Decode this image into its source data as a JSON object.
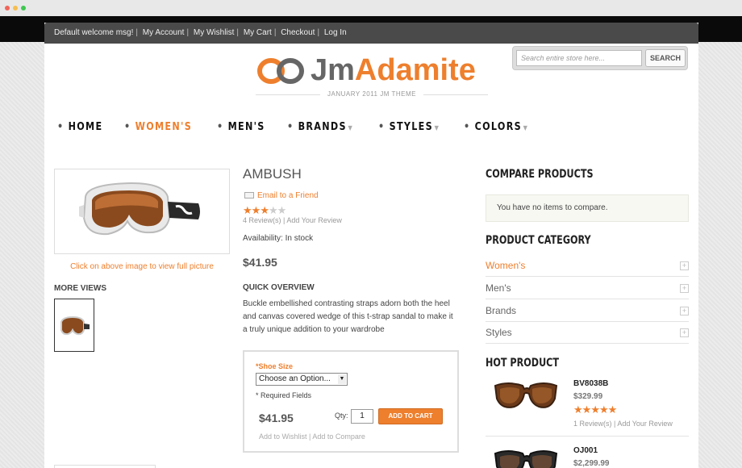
{
  "colors": {
    "accent": "#ee7f2d",
    "topbar": "#4a4a4a"
  },
  "toplinks": [
    "Default welcome msg!",
    "My Account",
    "My Wishlist",
    "My Cart",
    "Checkout",
    "Log In"
  ],
  "search": {
    "placeholder": "Search entire store here...",
    "button": "SEARCH"
  },
  "logo": {
    "part1": "Jm",
    "part2": "Adamite",
    "tagline": "JANUARY 2011 JM THEME"
  },
  "nav": [
    "HOME",
    "WOMEN'S",
    "MEN'S",
    "BRANDS",
    "STYLES",
    "COLORS"
  ],
  "nav_active": "WOMEN'S",
  "product": {
    "name": "AMBUSH",
    "email_friend": "Email to a Friend",
    "rating": 3,
    "reviews": "4 Review(s)",
    "add_review": "Add Your Review",
    "availability": "Availability: In stock",
    "price": "$41.95",
    "click_note": "Click on above image to view full picture",
    "more_views": "MORE VIEWS",
    "quick_overview_title": "QUICK OVERVIEW",
    "quick_overview": "Buckle embellished contrasting straps adorn both the heel and canvas covered wedge of this t-strap sandal to make it a truly unique addition to your wardrobe"
  },
  "options": {
    "shoe_size_label": "*Shoe Size",
    "shoe_size_value": "Choose an Option...",
    "required": "* Required Fields",
    "price": "$41.95",
    "qty_label": "Qty:",
    "qty_value": "1",
    "add_to_cart": "ADD TO CART",
    "add_to_wishlist": "Add to Wishlist",
    "add_to_compare": "Add to Compare"
  },
  "sidebar": {
    "compare_title": "COMPARE PRODUCTS",
    "compare_empty": "You have no items to compare.",
    "category_title": "PRODUCT CATEGORY",
    "categories": [
      "Women's",
      "Men's",
      "Brands",
      "Styles"
    ],
    "hot_title": "HOT PRODUCT",
    "hot": [
      {
        "name": "BV8038B",
        "price": "$329.99",
        "rating": 5,
        "reviews": "1 Review(s)",
        "add_review": "Add Your Review"
      },
      {
        "name": "OJ001",
        "price": "$2,299.99"
      }
    ]
  }
}
